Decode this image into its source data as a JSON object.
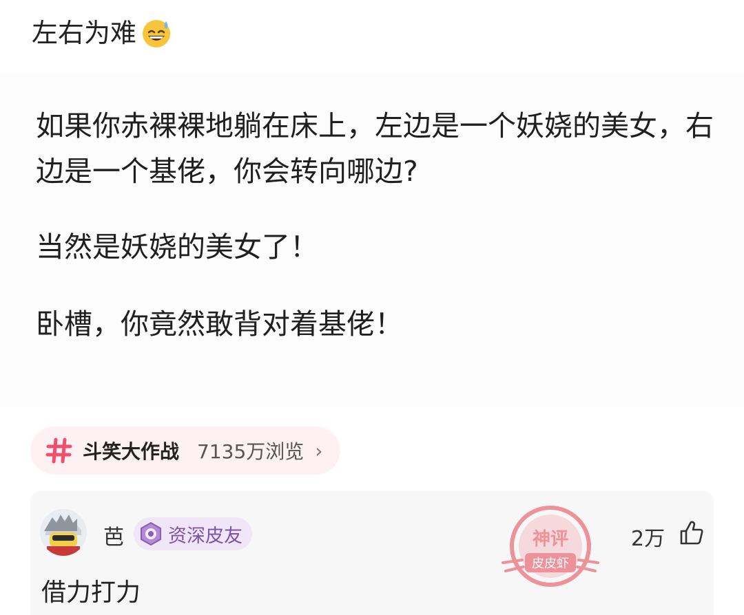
{
  "post": {
    "title": "左右为难",
    "title_emoji": "sweat-smile-emoji",
    "paragraphs": [
      "如果你赤裸裸地躺在床上，左边是一个妖娆的美女，右边是一个基佬，你会转向哪边?",
      "当然是妖娆的美女了！",
      "卧槽，你竟然敢背对着基佬！"
    ]
  },
  "topic": {
    "icon": "hash-icon",
    "name": "斗笑大作战",
    "views": "7135万浏览",
    "chevron": "›"
  },
  "comment": {
    "username": "芭",
    "badge_label": "资深皮友",
    "likes": "2万",
    "text": "借力打力",
    "watermark_lines": [
      "神评",
      "皮皮虾"
    ]
  },
  "colors": {
    "topic_accent": "#f0506e",
    "badge_text": "#7a52a8",
    "watermark": "#e8404f"
  }
}
